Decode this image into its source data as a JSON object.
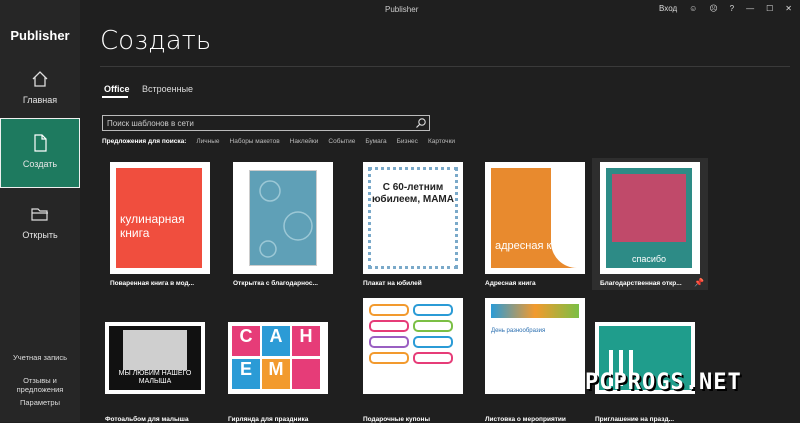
{
  "app": {
    "name": "Publisher",
    "window_title": "Publisher",
    "signin": "Вход"
  },
  "nav": {
    "home": "Главная",
    "create": "Создать",
    "open": "Открыть"
  },
  "side_bottom": {
    "account": "Учетная запись",
    "feedback": "Отзывы и предложения",
    "options": "Параметры"
  },
  "page": {
    "title": "Создать"
  },
  "tabs": [
    "Office",
    "Встроенные"
  ],
  "search": {
    "placeholder": "Поиск шаблонов в сети"
  },
  "suggestions": {
    "label": "Предложения для поиска:",
    "items": [
      "Личные",
      "Наборы макетов",
      "Наклейки",
      "Событие",
      "Бумага",
      "Бизнес",
      "Карточки"
    ]
  },
  "templates": [
    {
      "caption": "Поваренная книга в мод...",
      "text": "кулинарная книга",
      "color": "#f04e3e"
    },
    {
      "caption": "Открытка с благодарнос...",
      "text": "",
      "color": "#5fa0b7"
    },
    {
      "caption": "Плакат на юбилей",
      "text": "С 60-летним юбилеем, МАМА",
      "color": "#ffffff"
    },
    {
      "caption": "Адресная книга",
      "text": "адресная книга",
      "color": "#e88a2e"
    },
    {
      "caption": "Благодарственная откр...",
      "text": "спасибо",
      "color": "#c04a6a"
    },
    {
      "caption": "Фотоальбом для малыша",
      "text": "МЫ ЛЮБИМ НАШЕГО МАЛЫША",
      "color": "#111111"
    },
    {
      "caption": "Гирлянда для праздника",
      "text": "С А Н Е М",
      "color": "#ffffff"
    },
    {
      "caption": "Подарочные купоны",
      "text": "",
      "color": "#ffffff"
    },
    {
      "caption": "Листовка о мероприятии",
      "text": "День разнообразия",
      "color": "#ffffff"
    },
    {
      "caption": "Приглашение на празд...",
      "text": "",
      "color": "#1f9d8c"
    }
  ],
  "watermark": "PCPROGS.NET"
}
